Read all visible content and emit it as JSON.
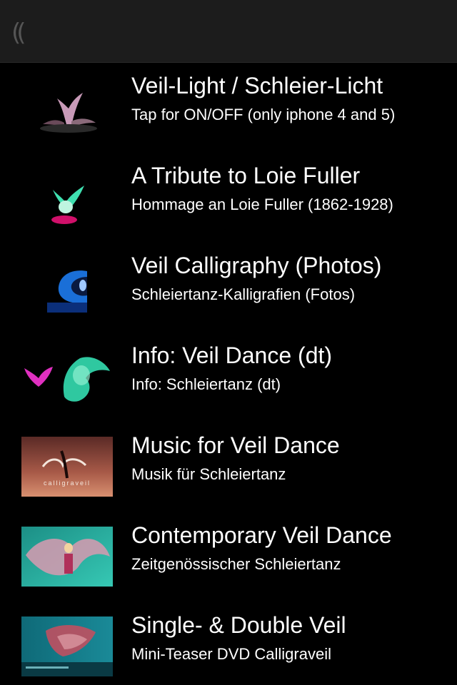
{
  "navbar": {
    "logo_icon": "calligraveil-logo-icon",
    "logo_glyph": "(("
  },
  "items": [
    {
      "title": "Veil-Light / Schleier-Licht",
      "subtitle": "Tap for ON/OFF (only iphone 4 and 5)",
      "icon": "veil-light-thumbnail",
      "accent": "#d8a8c8"
    },
    {
      "title": "A Tribute to Loie Fuller",
      "subtitle": "Hommage an Loie Fuller (1862-1928)",
      "icon": "loie-fuller-thumbnail",
      "accent": "#3fe0b0"
    },
    {
      "title": "Veil Calligraphy (Photos)",
      "subtitle": "Schleiertanz-Kalligrafien (Fotos)",
      "icon": "veil-calligraphy-thumbnail",
      "accent": "#2a7fe0"
    },
    {
      "title": "Info: Veil Dance (dt)",
      "subtitle": "Info: Schleiertanz (dt)",
      "icon": "info-veil-dance-thumbnail",
      "accent": "#30d0a0"
    },
    {
      "title": "Music for Veil Dance",
      "subtitle": "Musik für Schleiertanz",
      "icon": "music-veil-dance-thumbnail",
      "thumb_text": "calligraveil",
      "accent": "#a85a48"
    },
    {
      "title": "Contemporary Veil Dance",
      "subtitle": "Zeitgenössischer Schleiertanz",
      "icon": "contemporary-veil-dance-thumbnail",
      "accent": "#2ab0a0"
    },
    {
      "title": "Single- & Double Veil",
      "subtitle": "Mini-Teaser DVD Calligraveil",
      "icon": "single-double-veil-thumbnail",
      "accent": "#c05060"
    }
  ]
}
